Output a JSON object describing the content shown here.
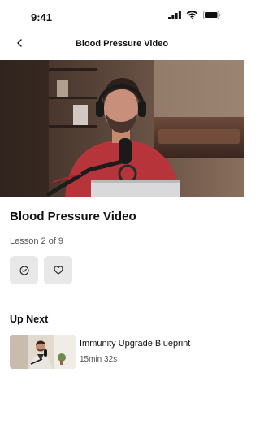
{
  "status_bar": {
    "time": "9:41"
  },
  "nav": {
    "title": "Blood Pressure Video"
  },
  "lesson": {
    "title": "Blood Pressure Video",
    "progress_text": "Lesson 2 of 9"
  },
  "actions": [
    {
      "icon": "check-circle-icon"
    },
    {
      "icon": "heart-icon"
    }
  ],
  "up_next": {
    "heading": "Up Next",
    "items": [
      {
        "title": "Immunity Upgrade Blueprint",
        "duration": "15min 32s"
      }
    ]
  }
}
